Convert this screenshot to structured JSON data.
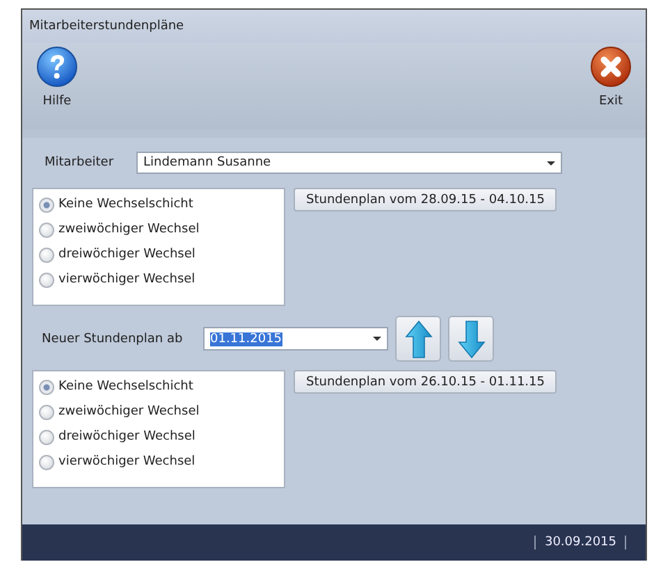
{
  "window": {
    "title": "Mitarbeiterstundenpläne"
  },
  "toolbar": [
    {
      "kind": "help",
      "label": "Hilfe"
    },
    {
      "kind": "exit",
      "label": "Exit"
    }
  ],
  "employee": {
    "label": "Mitarbeiter",
    "value": "Lindemann Susanne"
  },
  "current_plan": {
    "options": [
      {
        "label": "Keine Wechselschicht",
        "selected": true
      },
      {
        "label": "zweiwöchiger  Wechsel",
        "selected": false
      },
      {
        "label": "dreiwöchiger Wechsel",
        "selected": false
      },
      {
        "label": "vierwöchiger Wechsel",
        "selected": false
      }
    ],
    "button": "Stundenplan vom 28.09.15 - 04.10.15"
  },
  "new_plan": {
    "label": "Neuer Stundenplan ab",
    "value": "01.11.2015",
    "options": [
      {
        "label": "Keine Wechselschicht",
        "selected": true
      },
      {
        "label": "zweiwöchiger  Wechsel",
        "selected": false
      },
      {
        "label": "dreiwöchiger Wechsel",
        "selected": false
      },
      {
        "label": "vierwöchiger Wechsel",
        "selected": false
      }
    ],
    "button": "Stundenplan vom 26.10.15 - 01.11.15"
  },
  "status_bar": {
    "date": "30.09.2015"
  }
}
